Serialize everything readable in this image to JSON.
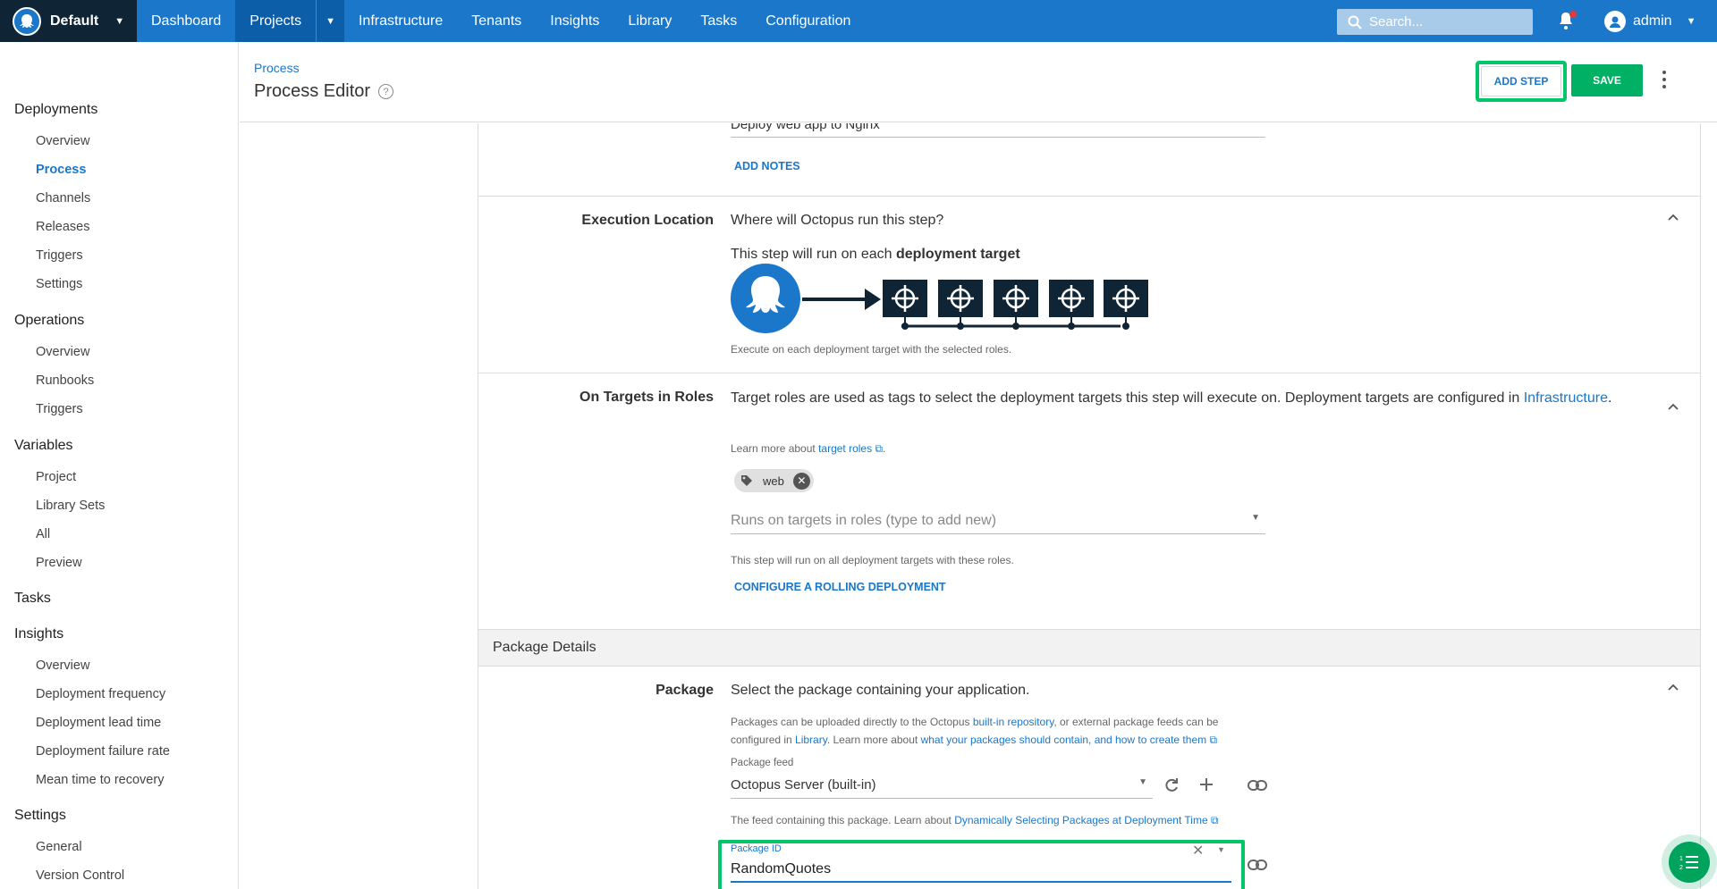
{
  "topnav": {
    "space": "Default",
    "items": [
      "Dashboard",
      "Projects",
      "Infrastructure",
      "Tenants",
      "Insights",
      "Library",
      "Tasks",
      "Configuration"
    ],
    "search_placeholder": "Search...",
    "user": "admin"
  },
  "sidebar": {
    "sections": [
      {
        "title": "Deployments",
        "items": [
          "Overview",
          "Process",
          "Channels",
          "Releases",
          "Triggers",
          "Settings"
        ]
      },
      {
        "title": "Operations",
        "items": [
          "Overview",
          "Runbooks",
          "Triggers"
        ]
      },
      {
        "title": "Variables",
        "items": [
          "Project",
          "Library Sets",
          "All",
          "Preview"
        ]
      },
      {
        "title": "Tasks",
        "items": []
      },
      {
        "title": "Insights",
        "items": [
          "Overview",
          "Deployment frequency",
          "Deployment lead time",
          "Deployment failure rate",
          "Mean time to recovery"
        ]
      },
      {
        "title": "Settings",
        "items": [
          "General",
          "Version Control"
        ]
      }
    ]
  },
  "header": {
    "breadcrumb": "Process",
    "title": "Process Editor",
    "add_step": "ADD STEP",
    "save": "SAVE"
  },
  "step_name": {
    "value": "Deploy web app to Nginx",
    "add_notes": "ADD NOTES"
  },
  "execution": {
    "label": "Execution Location",
    "question": "Where will Octopus run this step?",
    "run_prefix": "This step will run on each ",
    "run_bold": "deployment target",
    "caption": "Execute on each deployment target with the selected roles."
  },
  "roles": {
    "label": "On Targets in Roles",
    "desc": "Target roles are used as tags to select the deployment targets this step will execute on. Deployment targets are configured in ",
    "desc_link": "Infrastructure",
    "learn_prefix": "Learn more about ",
    "learn_link": "target roles",
    "chip": "web",
    "placeholder": "Runs on targets in roles (type to add new)",
    "helper": "This step will run on all deployment targets with these roles.",
    "rolling": "CONFIGURE A ROLLING DEPLOYMENT"
  },
  "package_details": {
    "heading": "Package Details",
    "label": "Package",
    "desc": "Select the package containing your application.",
    "info_1": "Packages can be uploaded directly to the Octopus ",
    "info_link1": "built-in repository",
    "info_2": ", or external package feeds can be",
    "info_3": "configured in ",
    "info_link2": "Library",
    "info_4": ". Learn more about ",
    "info_link3": "what your packages should contain, and how to create them",
    "feed_label": "Package feed",
    "feed_value": "Octopus Server (built-in)",
    "feed_help_prefix": "The feed containing this package. Learn about ",
    "feed_help_link": "Dynamically Selecting Packages at Deployment Time",
    "pkg_id_label": "Package ID",
    "pkg_id_value": "RandomQuotes"
  }
}
